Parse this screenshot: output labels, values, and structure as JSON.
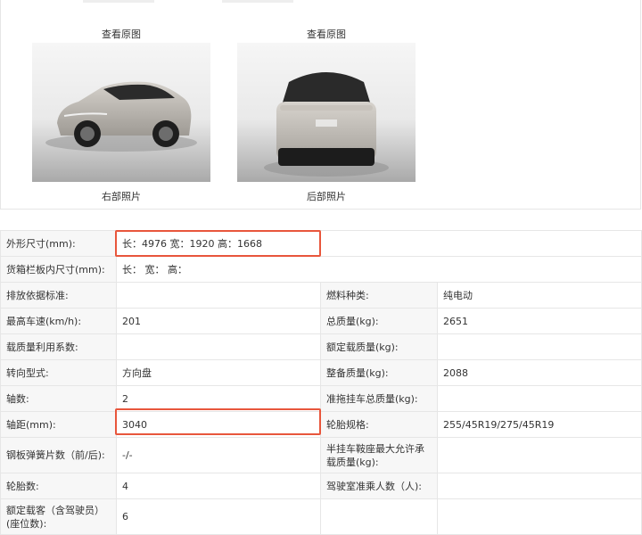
{
  "photos": [
    {
      "view_link": "查看原图",
      "caption": "右部照片"
    },
    {
      "view_link": "查看原图",
      "caption": "后部照片"
    }
  ],
  "specs": {
    "exterior_dims": {
      "label": "外形尺寸(mm):",
      "value": "长：4976 宽：1920 高：1668"
    },
    "cargo_dims": {
      "label": "货箱栏板内尺寸(mm):",
      "value": "长：  宽：  高："
    },
    "emission_std": {
      "label": "排放依据标准:",
      "value": ""
    },
    "fuel_type": {
      "label": "燃料种类:",
      "value": "纯电动"
    },
    "top_speed": {
      "label": "最高车速(km/h):",
      "value": "201"
    },
    "gross_mass": {
      "label": "总质量(kg):",
      "value": "2651"
    },
    "load_util": {
      "label": "载质量利用系数:",
      "value": ""
    },
    "rated_load": {
      "label": "额定载质量(kg):",
      "value": ""
    },
    "steering": {
      "label": "转向型式:",
      "value": "方向盘"
    },
    "curb_mass": {
      "label": "整备质量(kg):",
      "value": "2088"
    },
    "axles": {
      "label": "轴数:",
      "value": "2"
    },
    "trailer_mass": {
      "label": "准拖挂车总质量(kg):",
      "value": ""
    },
    "wheelbase": {
      "label": "轴距(mm):",
      "value": "3040"
    },
    "tire_spec": {
      "label": "轮胎规格:",
      "value": "255/45R19/275/45R19"
    },
    "leaf_springs": {
      "label": "钢板弹簧片数（前/后):",
      "value": "-/-"
    },
    "saddle_load": {
      "label": "半挂车鞍座最大允许承载质量(kg):",
      "value": ""
    },
    "tire_count": {
      "label": "轮胎数:",
      "value": "4"
    },
    "cab_seats": {
      "label": "驾驶室准乘人数（人):",
      "value": ""
    },
    "passengers": {
      "label": "额定载客（含驾驶员）(座位数):",
      "value": "6"
    }
  },
  "colors": {
    "highlight": "#e8563c",
    "label_bg": "#f7f7f7",
    "border": "#e6e6e6"
  }
}
